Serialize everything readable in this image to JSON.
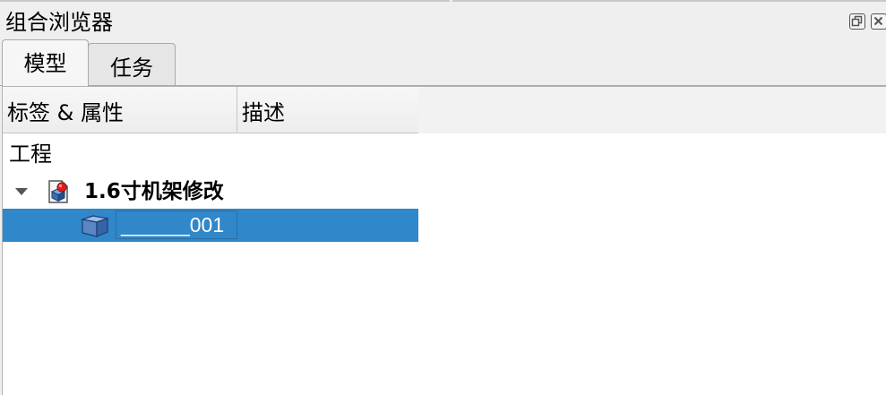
{
  "window": {
    "title": "组合浏览器"
  },
  "tabs": [
    {
      "label": "模型",
      "active": true
    },
    {
      "label": "任务",
      "active": false
    }
  ],
  "tree": {
    "columns": {
      "label": "标签 & 属性",
      "description": "描述"
    },
    "group_label": "工程",
    "document": {
      "label": "1.6寸机架修改",
      "expanded": true,
      "icon": "document-icon"
    },
    "selected_item": {
      "label": "______001",
      "icon": "part-icon"
    }
  },
  "colors": {
    "selection": "#3087c9",
    "background": "#efefef",
    "panel": "#ffffff"
  }
}
